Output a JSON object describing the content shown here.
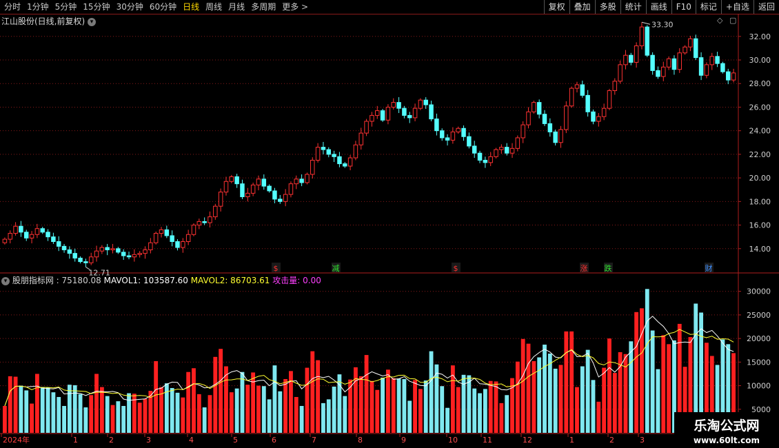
{
  "toolbar": {
    "periods": [
      "分时",
      "1分钟",
      "5分钟",
      "15分钟",
      "30分钟",
      "60分钟",
      "日线",
      "周线",
      "月线",
      "多周期",
      "更多"
    ],
    "active_index": 6,
    "more_arrow": ">",
    "actions": [
      "复权",
      "叠加",
      "多股",
      "统计",
      "画线",
      "F10",
      "标记",
      "+自选",
      "返回"
    ]
  },
  "price_panel": {
    "title": "江山股份(日线,前复权)",
    "high_label": "33.30",
    "low_label": "12.71",
    "event_markers": [
      {
        "text": "$",
        "color": "#ff3030"
      },
      {
        "text": "减",
        "color": "#30e030"
      },
      {
        "text": "$",
        "color": "#ff3030"
      },
      {
        "text": "涨",
        "color": "#ff3030"
      },
      {
        "text": "跌",
        "color": "#30e030"
      },
      {
        "text": "财",
        "color": "#4090ff"
      }
    ]
  },
  "volume_panel": {
    "title": "股朋指标网",
    "value_text": ": 75180.08",
    "mavol1_text": "MAVOL1: 103587.60",
    "mavol2_text": "MAVOL2: 86703.61",
    "attack_text": "攻击量: 0.00",
    "colors": {
      "value": "#d0d0d0",
      "mavol1": "#ffffff",
      "mavol2": "#ffff30",
      "attack": "#ff40ff"
    }
  },
  "x_axis": {
    "labels": [
      "2024年",
      "1",
      "2",
      "3",
      "4",
      "5",
      "6",
      "7",
      "8",
      "9",
      "10",
      "11",
      "12",
      "1",
      "2",
      "3"
    ]
  },
  "watermark": {
    "title": "乐淘公式网",
    "url": "www.60lt.com"
  },
  "chart_data": [
    {
      "type": "candlestick",
      "y_ticks": [
        14.0,
        16.0,
        18.0,
        20.0,
        22.0,
        24.0,
        26.0,
        28.0,
        30.0,
        32.0
      ],
      "ylim": [
        12.0,
        33.8
      ],
      "grid": true,
      "up_color": "#ff3232",
      "down_color": "#54ffff",
      "series_close": [
        14.8,
        15.3,
        15.9,
        15.4,
        14.9,
        15.2,
        15.7,
        15.4,
        15.0,
        14.6,
        14.2,
        13.9,
        13.6,
        13.2,
        12.9,
        12.8,
        13.3,
        13.8,
        14.1,
        13.9,
        14.0,
        13.7,
        13.4,
        13.3,
        13.5,
        13.6,
        13.9,
        14.5,
        15.3,
        15.6,
        15.1,
        14.6,
        14.1,
        14.6,
        15.2,
        16.0,
        16.3,
        16.2,
        16.7,
        17.6,
        18.8,
        19.7,
        20.1,
        19.5,
        18.4,
        18.7,
        19.4,
        19.9,
        19.3,
        18.9,
        18.2,
        18.0,
        18.6,
        19.5,
        19.9,
        19.6,
        20.3,
        21.5,
        22.6,
        22.4,
        22.0,
        21.8,
        21.2,
        21.0,
        21.7,
        22.8,
        23.8,
        24.8,
        25.3,
        25.7,
        24.9,
        26.0,
        26.4,
        25.9,
        25.3,
        25.1,
        25.9,
        26.6,
        26.2,
        25.0,
        24.0,
        23.4,
        23.2,
        23.9,
        24.2,
        23.5,
        22.7,
        22.1,
        21.5,
        21.3,
        21.8,
        22.4,
        22.6,
        22.1,
        22.5,
        23.4,
        24.5,
        25.6,
        26.4,
        25.4,
        24.6,
        23.9,
        23.0,
        24.1,
        26.1,
        27.6,
        27.9,
        27.0,
        25.6,
        24.8,
        25.2,
        25.9,
        27.4,
        28.2,
        29.6,
        30.4,
        29.8,
        31.2,
        32.8,
        30.4,
        29.1,
        28.6,
        29.4,
        30.1,
        29.2,
        30.6,
        31.1,
        31.8,
        30.2,
        28.7,
        29.6,
        30.3,
        29.7,
        29.0,
        28.3,
        28.9
      ]
    },
    {
      "type": "bar",
      "y_ticks": [
        5000,
        10000,
        15000,
        20000,
        25000,
        30000
      ],
      "ylim": [
        0,
        32000
      ],
      "series": [
        {
          "name": "MAVOL1",
          "color": "#ffffff",
          "type": "line"
        },
        {
          "name": "MAVOL2",
          "color": "#ffff30",
          "type": "line"
        }
      ]
    }
  ]
}
